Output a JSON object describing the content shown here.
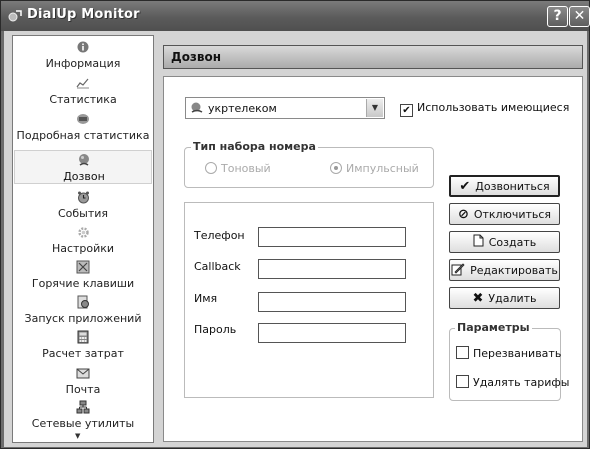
{
  "window": {
    "title": "DialUp Monitor",
    "help_glyph": "?",
    "close_glyph": "✕"
  },
  "sidebar": {
    "items": [
      {
        "label": "Информация",
        "icon": "info-icon"
      },
      {
        "label": "Статистика",
        "icon": "chart-icon"
      },
      {
        "label": "Подробная статистика",
        "icon": "detail-stats-icon"
      },
      {
        "label": "Дозвон",
        "icon": "globe-phone-icon",
        "active": true
      },
      {
        "label": "События",
        "icon": "alarm-clock-icon"
      },
      {
        "label": "Настройки",
        "icon": "gear-icon"
      },
      {
        "label": "Горячие клавиши",
        "icon": "hotkeys-icon"
      },
      {
        "label": "Запуск приложений",
        "icon": "app-launch-icon"
      },
      {
        "label": "Расчет затрат",
        "icon": "calculator-icon"
      },
      {
        "label": "Почта",
        "icon": "mail-icon"
      },
      {
        "label": "Сетевые утилиты",
        "icon": "network-icon"
      }
    ]
  },
  "panel": {
    "header": "Дозвон"
  },
  "connection": {
    "selected": "укртелеком"
  },
  "use_existing": {
    "label": "Использовать имеющиеся",
    "checked": true
  },
  "dial_type": {
    "legend": "Тип набора номера",
    "tone_label": "Тоновый",
    "pulse_label": "Импульсный",
    "selected": "Импульсный"
  },
  "fields": {
    "phone_label": "Телефон",
    "phone_value": "",
    "callback_label": "Callback",
    "callback_value": "",
    "name_label": "Имя",
    "name_value": "",
    "password_label": "Пароль",
    "password_value": ""
  },
  "buttons": {
    "dial": "Дозвониться",
    "disconnect": "Отключиться",
    "create": "Создать",
    "edit": "Редактировать",
    "delete": "Удалить"
  },
  "params": {
    "legend": "Параметры",
    "redial_label": "Перезванивать",
    "redial_checked": false,
    "delete_tariffs_label": "Удалять тарифы",
    "delete_tariffs_checked": false
  }
}
